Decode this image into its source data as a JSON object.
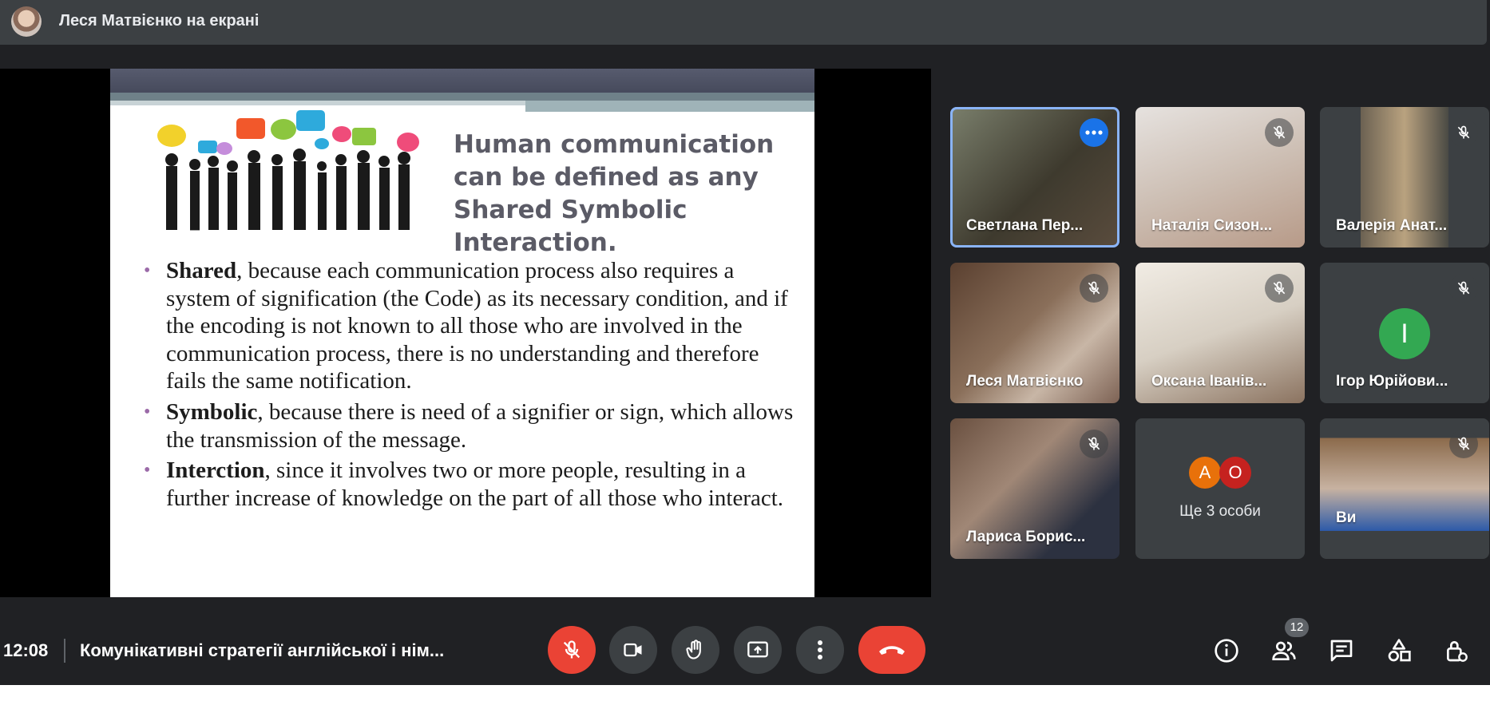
{
  "topbar": {
    "presenter_label": "Леся Матвієнко на екрані"
  },
  "slide": {
    "headline": "Human communication can be defined as any Shared Symbolic Interaction.",
    "bullets": [
      {
        "term": "Shared",
        "text": ", because each communication process also requires a system of signification (the Code) as its necessary condition, and if the encoding is not known to all those who are involved in the communication process, there is no understanding and therefore fails the same notification."
      },
      {
        "term": "Symbolic",
        "text": ", because there is need of a signifier or sign, which allows the transmission of the message."
      },
      {
        "term": "Interction",
        "text": ", since it involves two or more people, resulting in a further increase of knowledge on the part of all those who interact."
      }
    ]
  },
  "participants": [
    {
      "name": "Светлана Пер...",
      "active": true
    },
    {
      "name": "Наталія Сизон..."
    },
    {
      "name": "Валерія Анат..."
    },
    {
      "name": "Леся Матвієнко"
    },
    {
      "name": "Оксана Іванів..."
    },
    {
      "name": "Ігор Юрійови...",
      "initial": "І"
    },
    {
      "name": "Лариса Борис..."
    },
    {
      "name": "Ще 3 особи",
      "avatars": [
        "A",
        "O"
      ]
    },
    {
      "name": "Ви"
    }
  ],
  "bottombar": {
    "time": "12:08",
    "meeting_title": "Комунікативні стратегії англійської і нім...",
    "people_count": "12"
  },
  "colors": {
    "accent": "#8ab4f8",
    "danger": "#ea4335",
    "surface": "#3c4043",
    "background": "#202124"
  },
  "icons": [
    "mic-off-icon",
    "camera-icon",
    "raise-hand-icon",
    "present-icon",
    "more-vert-icon",
    "hang-up-icon",
    "info-icon",
    "people-icon",
    "chat-icon",
    "activities-icon",
    "host-controls-icon"
  ]
}
